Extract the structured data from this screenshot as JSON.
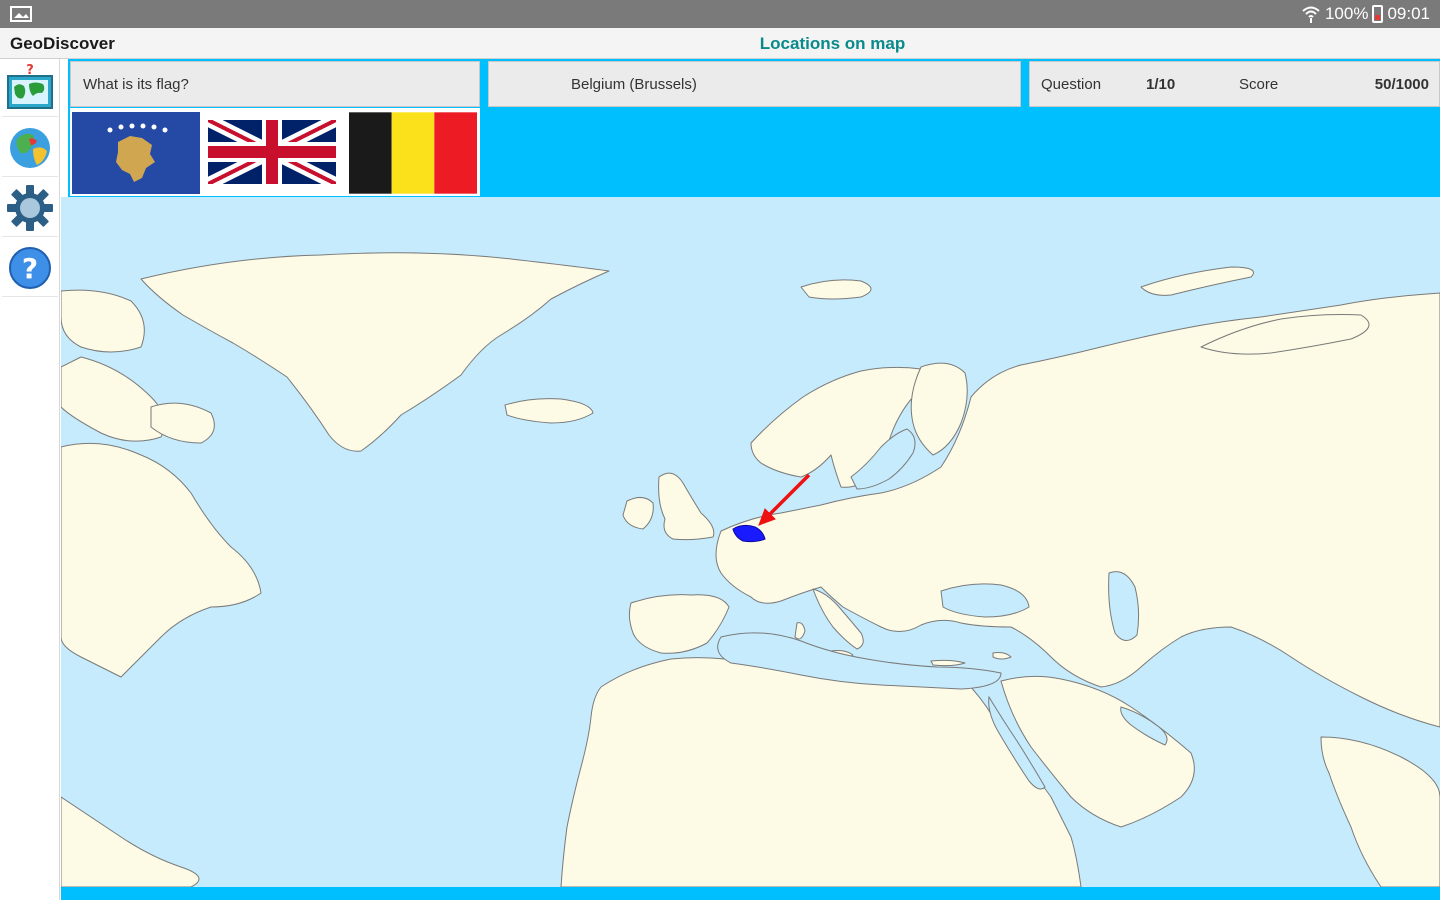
{
  "status_bar": {
    "battery": "100%",
    "time": "09:01",
    "icons": [
      "screenshot-icon",
      "wifi-icon",
      "battery-icon"
    ]
  },
  "app": {
    "name": "GeoDiscover",
    "screen_title": "Locations on map"
  },
  "sidebar": {
    "items": [
      {
        "name": "map-quiz",
        "icon": "map-quiz-icon"
      },
      {
        "name": "globe",
        "icon": "globe-icon"
      },
      {
        "name": "settings",
        "icon": "gear-icon"
      },
      {
        "name": "help",
        "icon": "help-icon"
      }
    ]
  },
  "quiz": {
    "question": "What is its flag?",
    "answer": "Belgium (Brussels)",
    "question_label": "Question",
    "question_value": "1/10",
    "score_label": "Score",
    "score_value": "50/1000",
    "flag_options": [
      "kosovo-flag",
      "united-kingdom-flag",
      "belgium-flag"
    ]
  },
  "colors": {
    "accent": "#00bfff",
    "sea": "#c5ebfc",
    "land": "#fdfbe6",
    "border": "#7a7a7a",
    "highlight": "#1a1aff",
    "arrow": "#ee1111",
    "title": "#0a8a8a"
  }
}
